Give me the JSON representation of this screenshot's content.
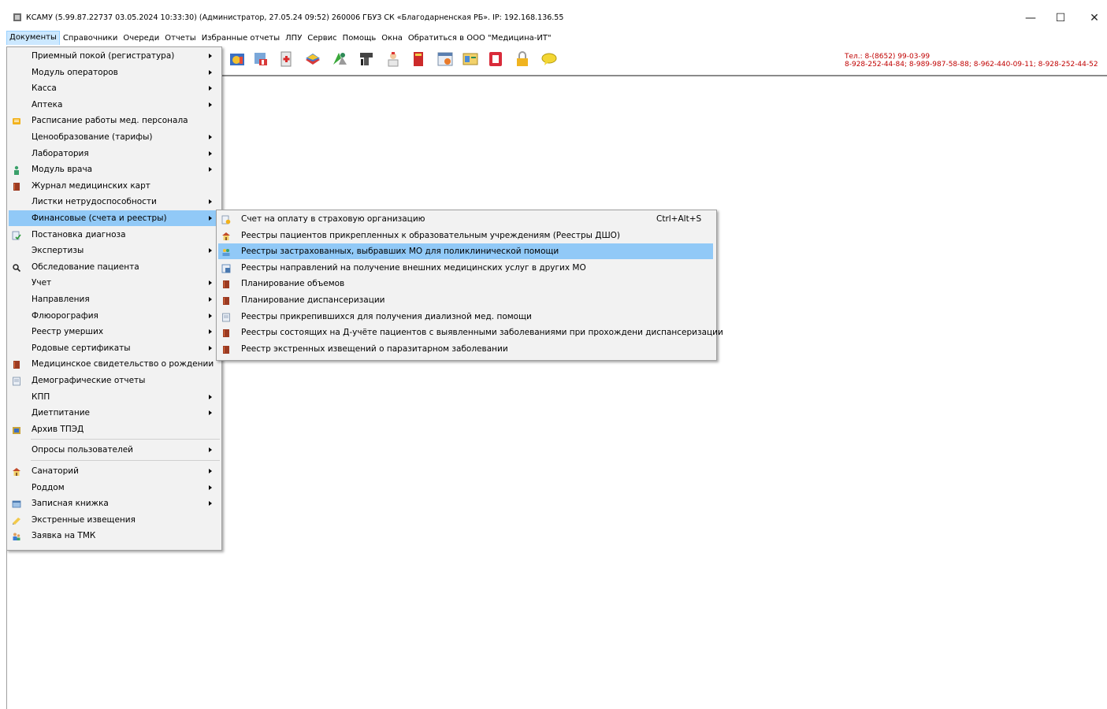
{
  "window": {
    "title": "КСАМУ (5.99.87.22737 03.05.2024 10:33:30) (Администратор, 27.05.24 09:52)  260006 ГБУЗ СК «Благодарненская РБ». IP: 192.168.136.55",
    "controls": {
      "minimize": "—",
      "maximize": "☐",
      "close": "✕"
    }
  },
  "menubar": {
    "items": [
      {
        "label": "Документы"
      },
      {
        "label": "Справочники"
      },
      {
        "label": "Очереди"
      },
      {
        "label": "Отчеты"
      },
      {
        "label": "Избранные отчеты"
      },
      {
        "label": "ЛПУ"
      },
      {
        "label": "Сервис"
      },
      {
        "label": "Помощь"
      },
      {
        "label": "Окна"
      },
      {
        "label": "Обратиться в ООО \"Медицина-ИТ\""
      }
    ]
  },
  "contact": {
    "line1": "Тел.: 8-(8652) 99-03-99",
    "line2": "8-928-252-44-84; 8-989-987-58-88; 8-962-440-09-11; 8-928-252-44-52"
  },
  "documents_menu": {
    "items": [
      {
        "label": "Приемный покой (регистратура)",
        "icon": "",
        "submenu": true
      },
      {
        "label": "Модуль операторов",
        "icon": "",
        "submenu": true
      },
      {
        "label": "Касса",
        "icon": "",
        "submenu": true
      },
      {
        "label": "Аптека",
        "icon": "",
        "submenu": true
      },
      {
        "label": "Расписание работы мед. персонала",
        "icon": "schedule-icon",
        "submenu": false
      },
      {
        "label": "Ценообразование (тарифы)",
        "icon": "",
        "submenu": true
      },
      {
        "label": "Лаборатория",
        "icon": "",
        "submenu": true
      },
      {
        "label": "Модуль врача",
        "icon": "doctor-icon",
        "submenu": true
      },
      {
        "label": "Журнал медицинских карт",
        "icon": "book-icon",
        "submenu": false
      },
      {
        "label": "Листки нетрудоспособности",
        "icon": "",
        "submenu": true
      },
      {
        "label": "Финансовые (счета и реестры)",
        "icon": "",
        "submenu": true
      },
      {
        "label": "Постановка диагноза",
        "icon": "diagnosis-icon",
        "submenu": false
      },
      {
        "label": "Экспертизы",
        "icon": "",
        "submenu": true
      },
      {
        "label": "Обследование пациента",
        "icon": "search-icon",
        "submenu": false
      },
      {
        "label": "Учет",
        "icon": "",
        "submenu": true
      },
      {
        "label": "Направления",
        "icon": "",
        "submenu": true
      },
      {
        "label": "Флюорография",
        "icon": "",
        "submenu": true
      },
      {
        "label": "Реестр умерших",
        "icon": "",
        "submenu": true
      },
      {
        "label": "Родовые сертификаты",
        "icon": "",
        "submenu": true
      },
      {
        "label": "Медицинское свидетельство о рождении",
        "icon": "book-icon",
        "submenu": false
      },
      {
        "label": "Демографические отчеты",
        "icon": "document-icon",
        "submenu": false
      },
      {
        "label": "КПП",
        "icon": "",
        "submenu": true
      },
      {
        "label": "Диетпитание",
        "icon": "",
        "submenu": true
      },
      {
        "label": "Архив ТПЭД",
        "icon": "archive-icon",
        "submenu": false
      },
      {
        "label": "Опросы пользователей",
        "icon": "",
        "submenu": true
      },
      {
        "label": "Санаторий",
        "icon": "house-icon",
        "submenu": true
      },
      {
        "label": "Роддом",
        "icon": "",
        "submenu": true
      },
      {
        "label": "Записная книжка",
        "icon": "notebook-icon",
        "submenu": true
      },
      {
        "label": "Экстренные извещения",
        "icon": "notice-icon",
        "submenu": false
      },
      {
        "label": "Заявка на ТМК",
        "icon": "users-icon",
        "submenu": false
      }
    ]
  },
  "finance_submenu": {
    "items": [
      {
        "label": "Счет на оплату в страховую организацию",
        "icon": "invoice-icon",
        "shortcut": "Ctrl+Alt+S"
      },
      {
        "label": "Реестры пациентов прикрепленных к образовательным учреждениям (Реестры ДШО)",
        "icon": "house-icon",
        "shortcut": ""
      },
      {
        "label": "Реестры застрахованных, выбравших МО для поликлинической помощи",
        "icon": "people-icon",
        "shortcut": ""
      },
      {
        "label": "Реестры направлений на получение внешних медицинских услуг в других МО",
        "icon": "referral-icon",
        "shortcut": ""
      },
      {
        "label": "Планирование объемов",
        "icon": "book-icon",
        "shortcut": ""
      },
      {
        "label": "Планирование диспансеризации",
        "icon": "book-icon",
        "shortcut": ""
      },
      {
        "label": "Реестры прикрепившихся для получения диализной мед. помощи",
        "icon": "document-icon",
        "shortcut": ""
      },
      {
        "label": "Реестры состоящих на Д-учёте пациентов с выявленными заболеваниями при прохождени диспансеризации",
        "icon": "book-icon",
        "shortcut": ""
      },
      {
        "label": "Реестр экстренных извещений о паразитарном заболевании",
        "icon": "book-icon",
        "shortcut": ""
      }
    ]
  }
}
